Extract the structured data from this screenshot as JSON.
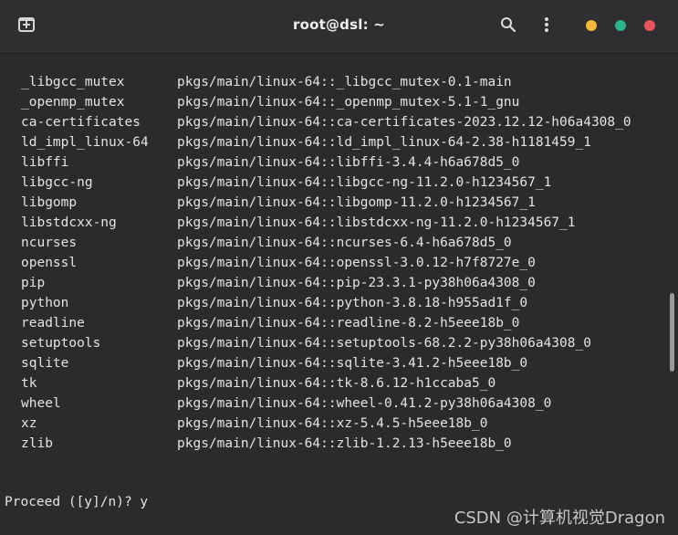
{
  "window": {
    "title": "root@dsl: ~",
    "controls": {
      "minimize_color": "#f4b93a",
      "maximize_color": "#2fb38f",
      "close_color": "#e8545c"
    },
    "icons": {
      "new_tab": "new-tab-icon",
      "search": "search-icon",
      "menu": "kebab-menu-icon"
    }
  },
  "terminal": {
    "packages": [
      {
        "name": "_libgcc_mutex",
        "spec": "pkgs/main/linux-64::_libgcc_mutex-0.1-main"
      },
      {
        "name": "_openmp_mutex",
        "spec": "pkgs/main/linux-64::_openmp_mutex-5.1-1_gnu"
      },
      {
        "name": "ca-certificates",
        "spec": "pkgs/main/linux-64::ca-certificates-2023.12.12-h06a4308_0"
      },
      {
        "name": "ld_impl_linux-64",
        "spec": "pkgs/main/linux-64::ld_impl_linux-64-2.38-h1181459_1"
      },
      {
        "name": "libffi",
        "spec": "pkgs/main/linux-64::libffi-3.4.4-h6a678d5_0"
      },
      {
        "name": "libgcc-ng",
        "spec": "pkgs/main/linux-64::libgcc-ng-11.2.0-h1234567_1"
      },
      {
        "name": "libgomp",
        "spec": "pkgs/main/linux-64::libgomp-11.2.0-h1234567_1"
      },
      {
        "name": "libstdcxx-ng",
        "spec": "pkgs/main/linux-64::libstdcxx-ng-11.2.0-h1234567_1"
      },
      {
        "name": "ncurses",
        "spec": "pkgs/main/linux-64::ncurses-6.4-h6a678d5_0"
      },
      {
        "name": "openssl",
        "spec": "pkgs/main/linux-64::openssl-3.0.12-h7f8727e_0"
      },
      {
        "name": "pip",
        "spec": "pkgs/main/linux-64::pip-23.3.1-py38h06a4308_0"
      },
      {
        "name": "python",
        "spec": "pkgs/main/linux-64::python-3.8.18-h955ad1f_0"
      },
      {
        "name": "readline",
        "spec": "pkgs/main/linux-64::readline-8.2-h5eee18b_0"
      },
      {
        "name": "setuptools",
        "spec": "pkgs/main/linux-64::setuptools-68.2.2-py38h06a4308_0"
      },
      {
        "name": "sqlite",
        "spec": "pkgs/main/linux-64::sqlite-3.41.2-h5eee18b_0"
      },
      {
        "name": "tk",
        "spec": "pkgs/main/linux-64::tk-8.6.12-h1ccaba5_0"
      },
      {
        "name": "wheel",
        "spec": "pkgs/main/linux-64::wheel-0.41.2-py38h06a4308_0"
      },
      {
        "name": "xz",
        "spec": "pkgs/main/linux-64::xz-5.4.5-h5eee18b_0"
      },
      {
        "name": "zlib",
        "spec": "pkgs/main/linux-64::zlib-1.2.13-h5eee18b_0"
      }
    ],
    "prompt": "Proceed ([y]/n)? y"
  },
  "watermark": "CSDN @计算机视觉Dragon"
}
